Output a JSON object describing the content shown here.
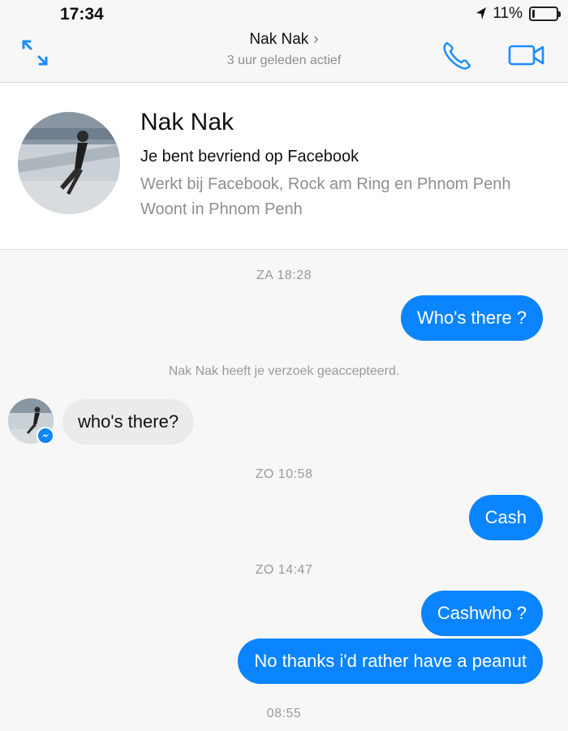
{
  "status_bar": {
    "time": "17:34",
    "battery_text": "11%",
    "battery_level": 0.11,
    "location_icon": "location-arrow-icon",
    "battery_icon": "battery-icon"
  },
  "nav": {
    "name": "Nak Nak",
    "chevron": "›",
    "subtitle": "3 uur geleden actief",
    "expand_icon": "expand-icon",
    "phone_icon": "phone-icon",
    "video_icon": "video-camera-icon",
    "accent": "#0b84ff"
  },
  "profile": {
    "name": "Nak Nak",
    "friend_text": "Je bent bevriend op Facebook",
    "work_text": "Werkt bij Facebook, Rock am Ring en Phnom Penh",
    "home_text": "Woont in Phnom Penh"
  },
  "conversation": {
    "stamp1": "ZA 18:28",
    "msg1": "Who's there ?",
    "system1": "Nak Nak heeft je verzoek geaccepteerd.",
    "msg2": "who's there?",
    "stamp2": "ZO 10:58",
    "msg3": "Cash",
    "stamp3": "ZO 14:47",
    "msg4": "Cashwho ?",
    "msg5": "No thanks i'd rather have a peanut",
    "stamp4": "08:55",
    "outgoing_color": "#0b84ff",
    "incoming_color": "#ebebeb"
  }
}
